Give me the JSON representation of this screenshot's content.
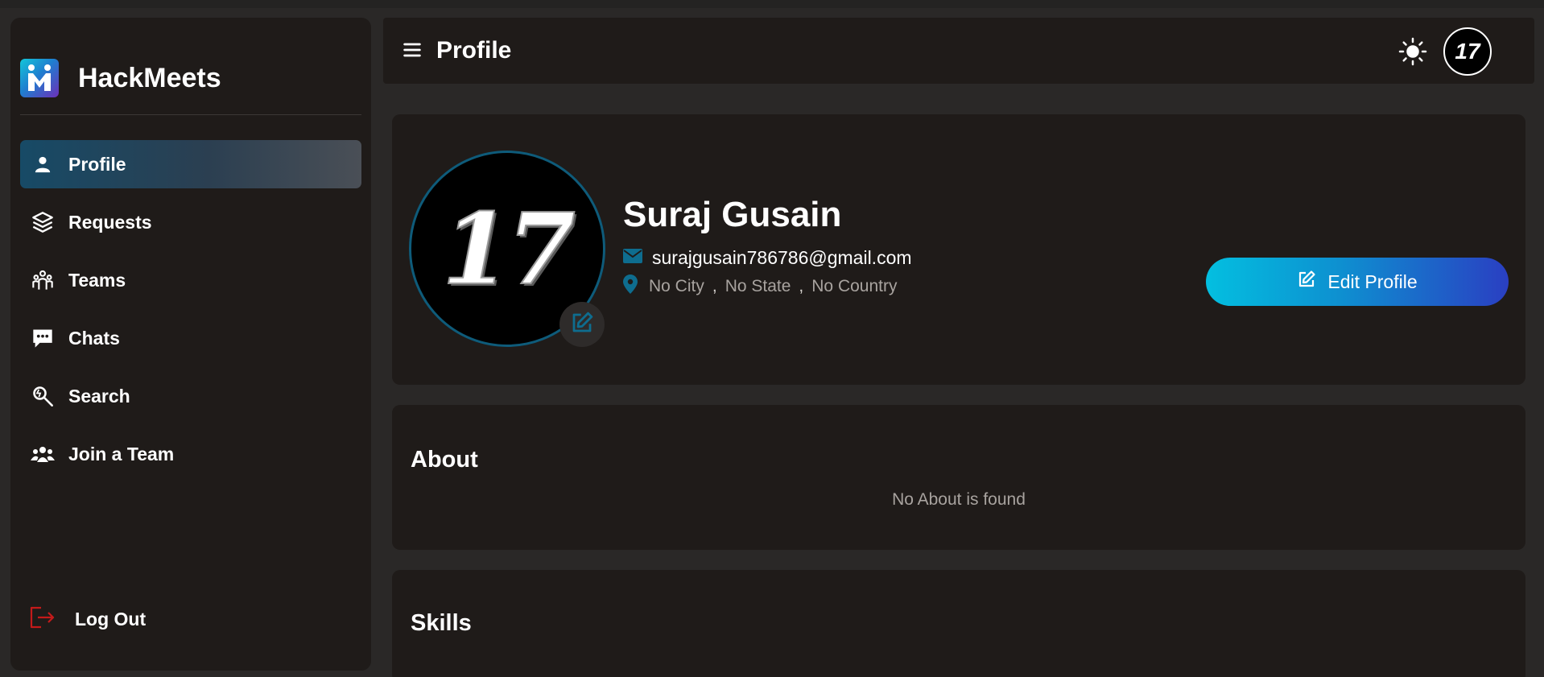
{
  "app": {
    "name": "HackMeets",
    "accent": "#0e8fd0"
  },
  "sidebar": {
    "items": [
      {
        "label": "Profile",
        "icon": "person-icon",
        "active": true
      },
      {
        "label": "Requests",
        "icon": "layers-icon",
        "active": false
      },
      {
        "label": "Teams",
        "icon": "team-icon",
        "active": false
      },
      {
        "label": "Chats",
        "icon": "chat-bubble-icon",
        "active": false
      },
      {
        "label": "Search",
        "icon": "search-icon",
        "active": false
      },
      {
        "label": "Join a Team",
        "icon": "users-icon",
        "active": false
      }
    ],
    "logout_label": "Log Out"
  },
  "header": {
    "title": "Profile",
    "avatar_text": "17"
  },
  "profile": {
    "avatar_text": "17",
    "name": "Suraj Gusain",
    "email": "surajgusain786786@gmail.com",
    "city": "No City",
    "state": "No State",
    "country": "No Country",
    "separator": ",",
    "edit_button_label": "Edit Profile"
  },
  "about": {
    "title": "About",
    "empty_text": "No About is found"
  },
  "skills": {
    "title": "Skills"
  }
}
